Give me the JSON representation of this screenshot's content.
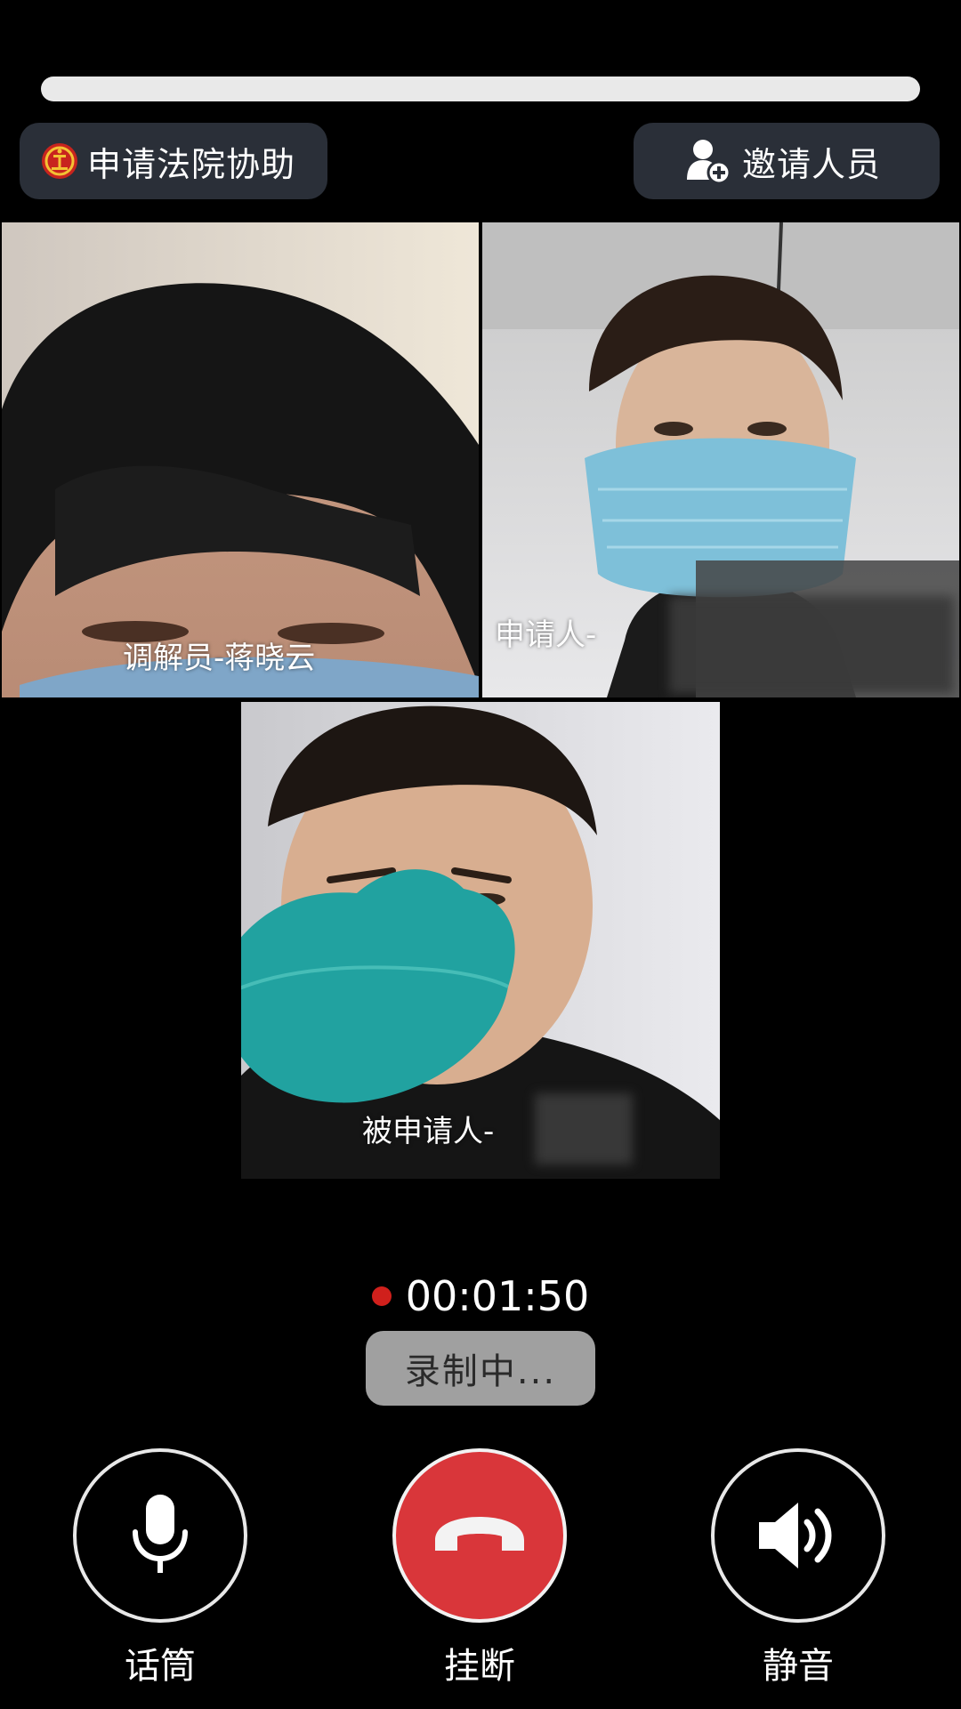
{
  "header": {
    "court_assist_label": "申请法院协助",
    "invite_label": "邀请人员"
  },
  "participants": [
    {
      "label": "调解员-蒋晓云"
    },
    {
      "label": "申请人-"
    },
    {
      "label": "被申请人-"
    }
  ],
  "call": {
    "elapsed": "00:01:50",
    "recording_status": "录制中..."
  },
  "controls": {
    "mic_label": "话筒",
    "hangup_label": "挂断",
    "mute_label": "静音"
  },
  "colors": {
    "hangup": "#d9363a",
    "record_dot": "#d0201c",
    "pill_bg": "#2a2f38"
  },
  "icons": {
    "court": "court-emblem-icon",
    "invite": "add-person-icon",
    "mic": "microphone-icon",
    "hangup": "phone-hangup-icon",
    "speaker": "speaker-icon"
  }
}
